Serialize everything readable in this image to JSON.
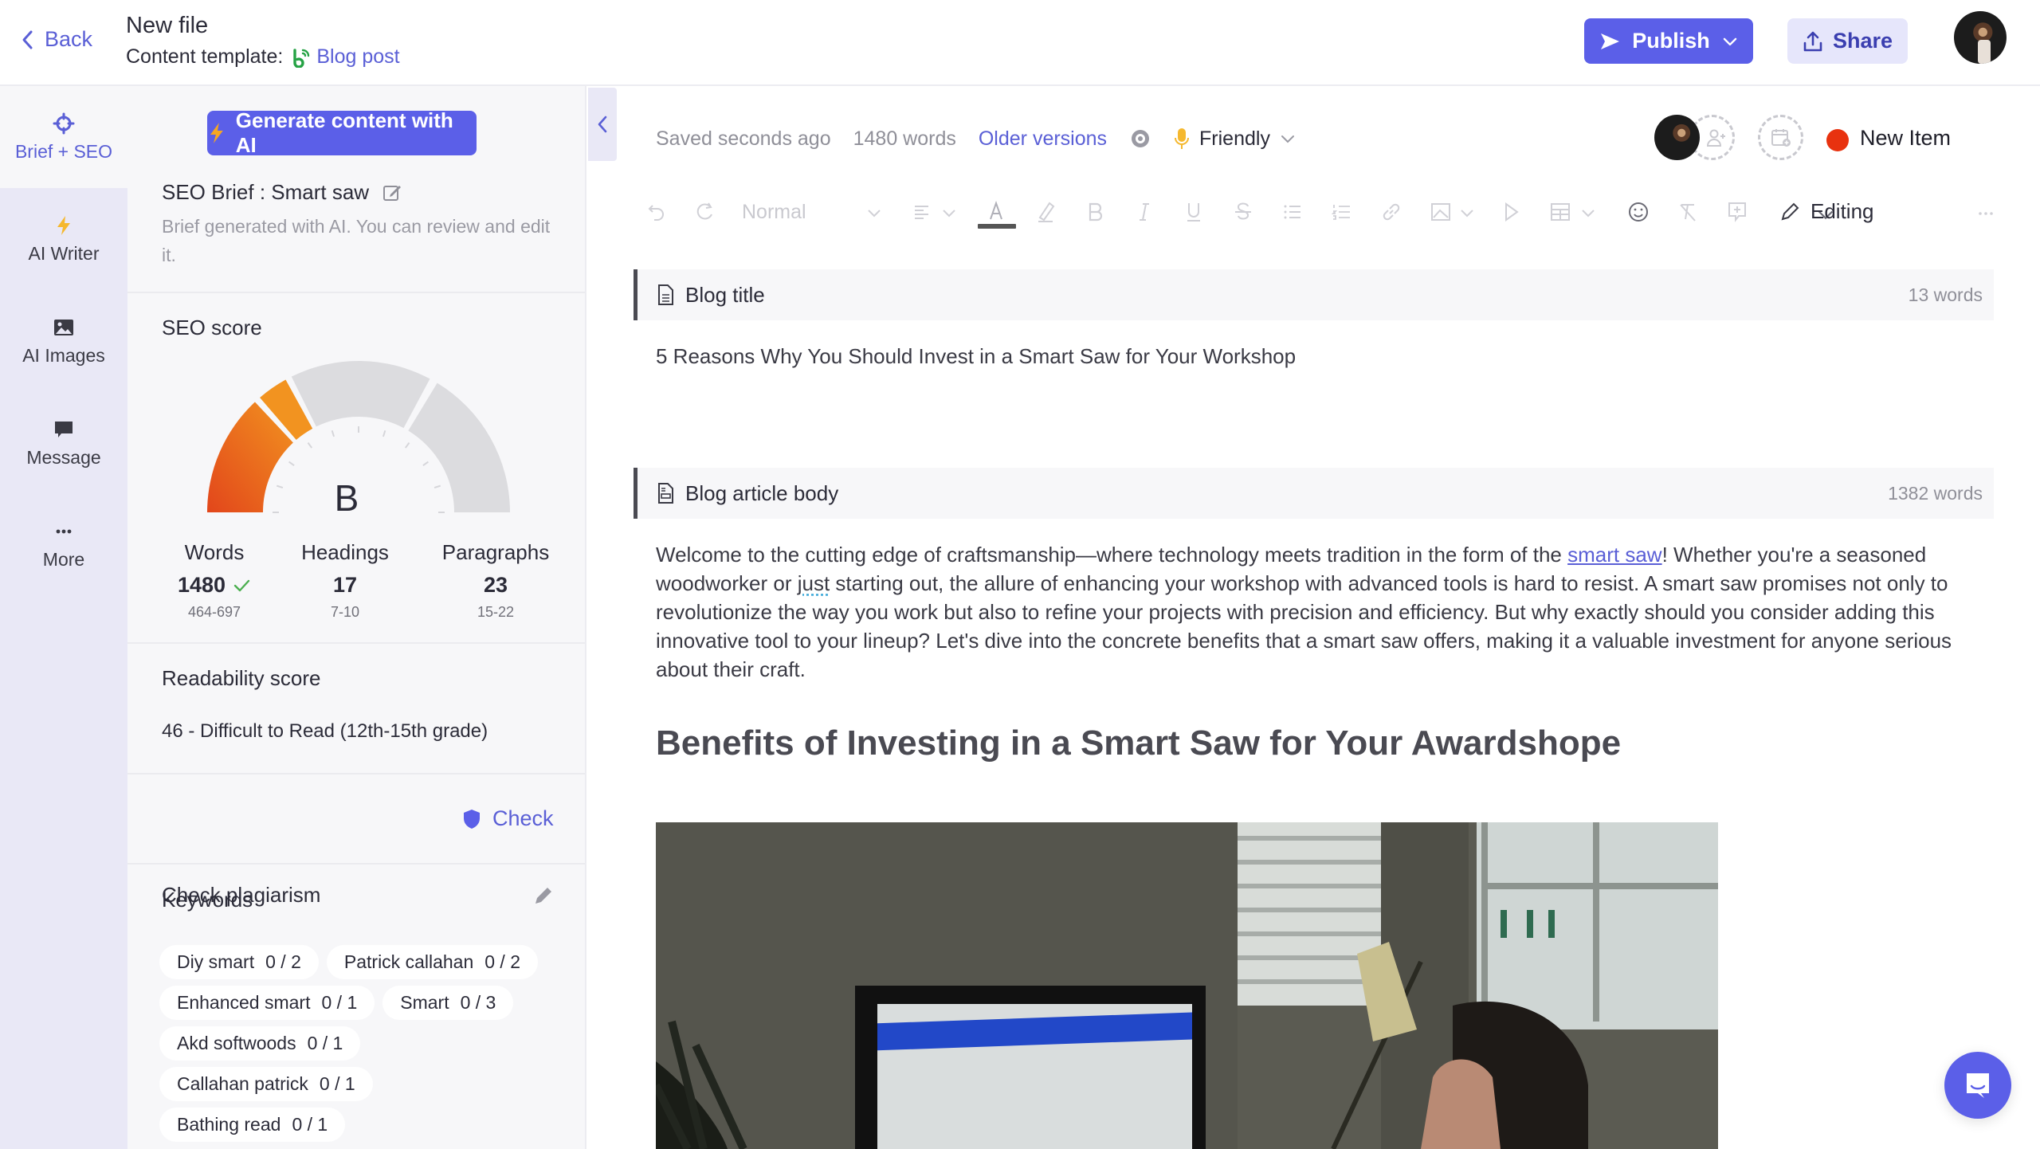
{
  "header": {
    "back_label": "Back",
    "file_title": "New file",
    "template_prefix": "Content template:",
    "template_name": "Blog post",
    "publish_label": "Publish",
    "share_label": "Share"
  },
  "rail": {
    "items": [
      {
        "label": "Brief + SEO",
        "icon": "crosshair-icon",
        "active": true
      },
      {
        "label": "AI Writer",
        "icon": "lightning-icon"
      },
      {
        "label": "AI Images",
        "icon": "image-icon"
      },
      {
        "label": "Message",
        "icon": "message-icon"
      },
      {
        "label": "More",
        "icon": "more-dots-icon"
      }
    ]
  },
  "seo_panel": {
    "generate_label": "Generate content with AI",
    "brief_title": "SEO Brief : Smart saw",
    "brief_desc": "Brief generated with AI. You can review and edit it.",
    "seo_score_title": "SEO score",
    "seo_grade": "B",
    "seo_score_fraction": 0.28,
    "stats": [
      {
        "label": "Words",
        "value": "1480",
        "range": "464-697",
        "ok": true
      },
      {
        "label": "Headings",
        "value": "17",
        "range": "7-10"
      },
      {
        "label": "Paragraphs",
        "value": "23",
        "range": "15-22"
      }
    ],
    "readability_title": "Readability score",
    "readability_value": "46 - Difficult to Read (12th-15th grade)",
    "plagiarism_title": "Check plagiarism",
    "plagiarism_button": "Check",
    "keywords_title": "Keywords",
    "keywords": [
      {
        "term": "Diy smart",
        "count": "0 / 2"
      },
      {
        "term": "Patrick callahan",
        "count": "0 / 2"
      },
      {
        "term": "Enhanced smart",
        "count": "0 / 1"
      },
      {
        "term": "Smart",
        "count": "0 / 3"
      },
      {
        "term": "Akd softwoods",
        "count": "0 / 1"
      },
      {
        "term": "Callahan patrick",
        "count": "0 / 1"
      },
      {
        "term": "Bathing read",
        "count": "0 / 1"
      }
    ]
  },
  "editor": {
    "saved_status": "Saved seconds ago",
    "word_count": "1480 words",
    "older_versions": "Older versions",
    "tone": "Friendly",
    "status_label": "New Item",
    "status_color": "#e8320f",
    "toolbar": {
      "style_select": "Normal",
      "mode_label": "Editing"
    },
    "blocks": [
      {
        "label": "Blog title",
        "count": "13 words"
      },
      {
        "label": "Blog article body",
        "count": "1382 words"
      }
    ],
    "title_text": "5 Reasons Why You Should Invest in a Smart Saw for Your Workshop",
    "body": {
      "p1_a": "Welcome to the cutting edge of craftsmanship—where technology meets tradition in the form of the ",
      "p1_link": "smart saw",
      "p1_b": "! Whether you're a seasoned woodworker or ",
      "p1_spell": "just",
      "p1_c": " starting out, the allure of enhancing your workshop with advanced tools is hard to resist. A smart saw promises not only to revolutionize the way you work but also to refine your projects with precision and efficiency. But why exactly should you consider adding this innovative tool to your lineup? Let's dive into the concrete benefits that a smart saw offers, making it a valuable investment for anyone serious about their craft.",
      "h2": "Benefits of Investing in a Smart Saw for Your Awardshope"
    }
  },
  "colors": {
    "accent": "#5b5fe8",
    "accent_text": "#5a5fd6",
    "rail_bg": "#e9e8f6",
    "panel_bg": "#f7f7f9"
  }
}
